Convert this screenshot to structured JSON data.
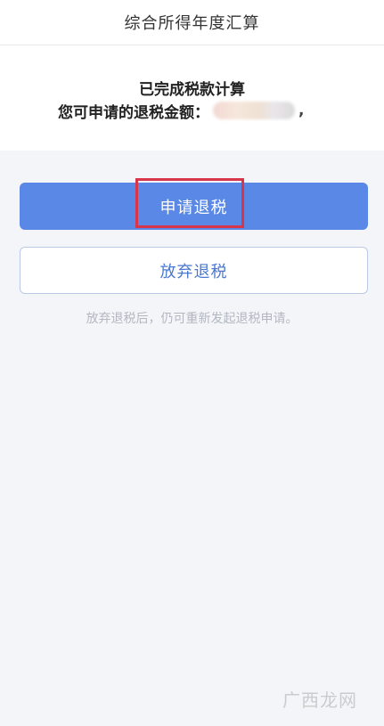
{
  "header": {
    "title": "综合所得年度汇算"
  },
  "result": {
    "status": "已完成税款计算",
    "amount_label": "您可申请的退税金额：",
    "amount_tail": ","
  },
  "actions": {
    "apply_label": "申请退税",
    "abandon_label": "放弃退税"
  },
  "hint": "放弃退税后，仍可重新发起退税申请。",
  "watermark": "广西龙网",
  "colors": {
    "primary": "#5a88e6",
    "highlight": "#d8344a",
    "background": "#f3f5f9"
  }
}
